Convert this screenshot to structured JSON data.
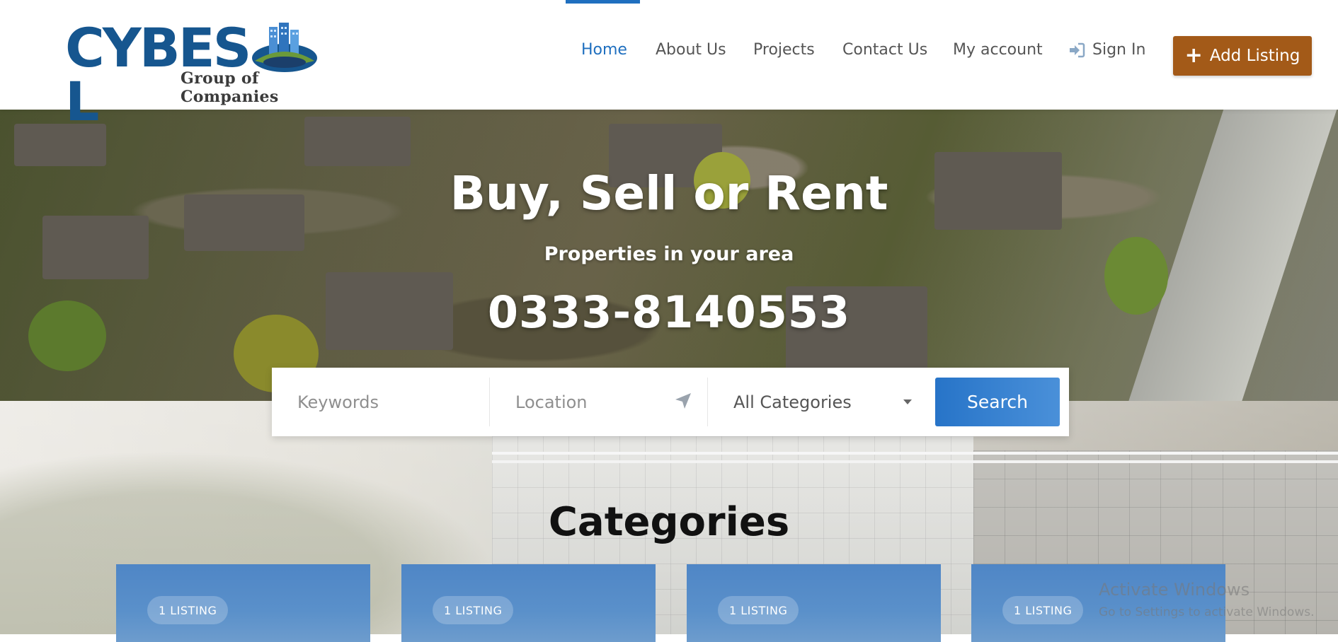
{
  "brand": {
    "logo_word_left": "CYBES",
    "logo_word_right": "L",
    "logo_subtitle": "Group of Companies"
  },
  "nav": {
    "items": [
      "Home",
      "About Us",
      "Projects",
      "Contact Us",
      "My account"
    ],
    "active": "Home",
    "sign_in": "Sign In",
    "add_listing": "Add Listing"
  },
  "hero": {
    "title": "Buy, Sell or Rent",
    "subtitle": "Properties in your area",
    "phone": "0333-8140553"
  },
  "search": {
    "keywords_placeholder": "Keywords",
    "location_placeholder": "Location",
    "category_selected": "All Categories",
    "button": "Search"
  },
  "categories": {
    "title": "Categories",
    "cards": [
      {
        "badge": "1 LISTING"
      },
      {
        "badge": "1 LISTING"
      },
      {
        "badge": "1 LISTING"
      },
      {
        "badge": "1 LISTING"
      }
    ]
  },
  "watermark": {
    "line1": "Activate Windows",
    "line2": "Go to Settings to activate Windows."
  },
  "colors": {
    "brand_blue": "#16568f",
    "nav_active": "#1f6fbf",
    "add_listing_bg": "#a35a18",
    "search_button": "#2b7cd0"
  },
  "icons": {
    "sign_in": "sign-in-icon",
    "add": "plus-icon",
    "location": "location-arrow-icon",
    "dropdown": "caret-down-icon"
  }
}
